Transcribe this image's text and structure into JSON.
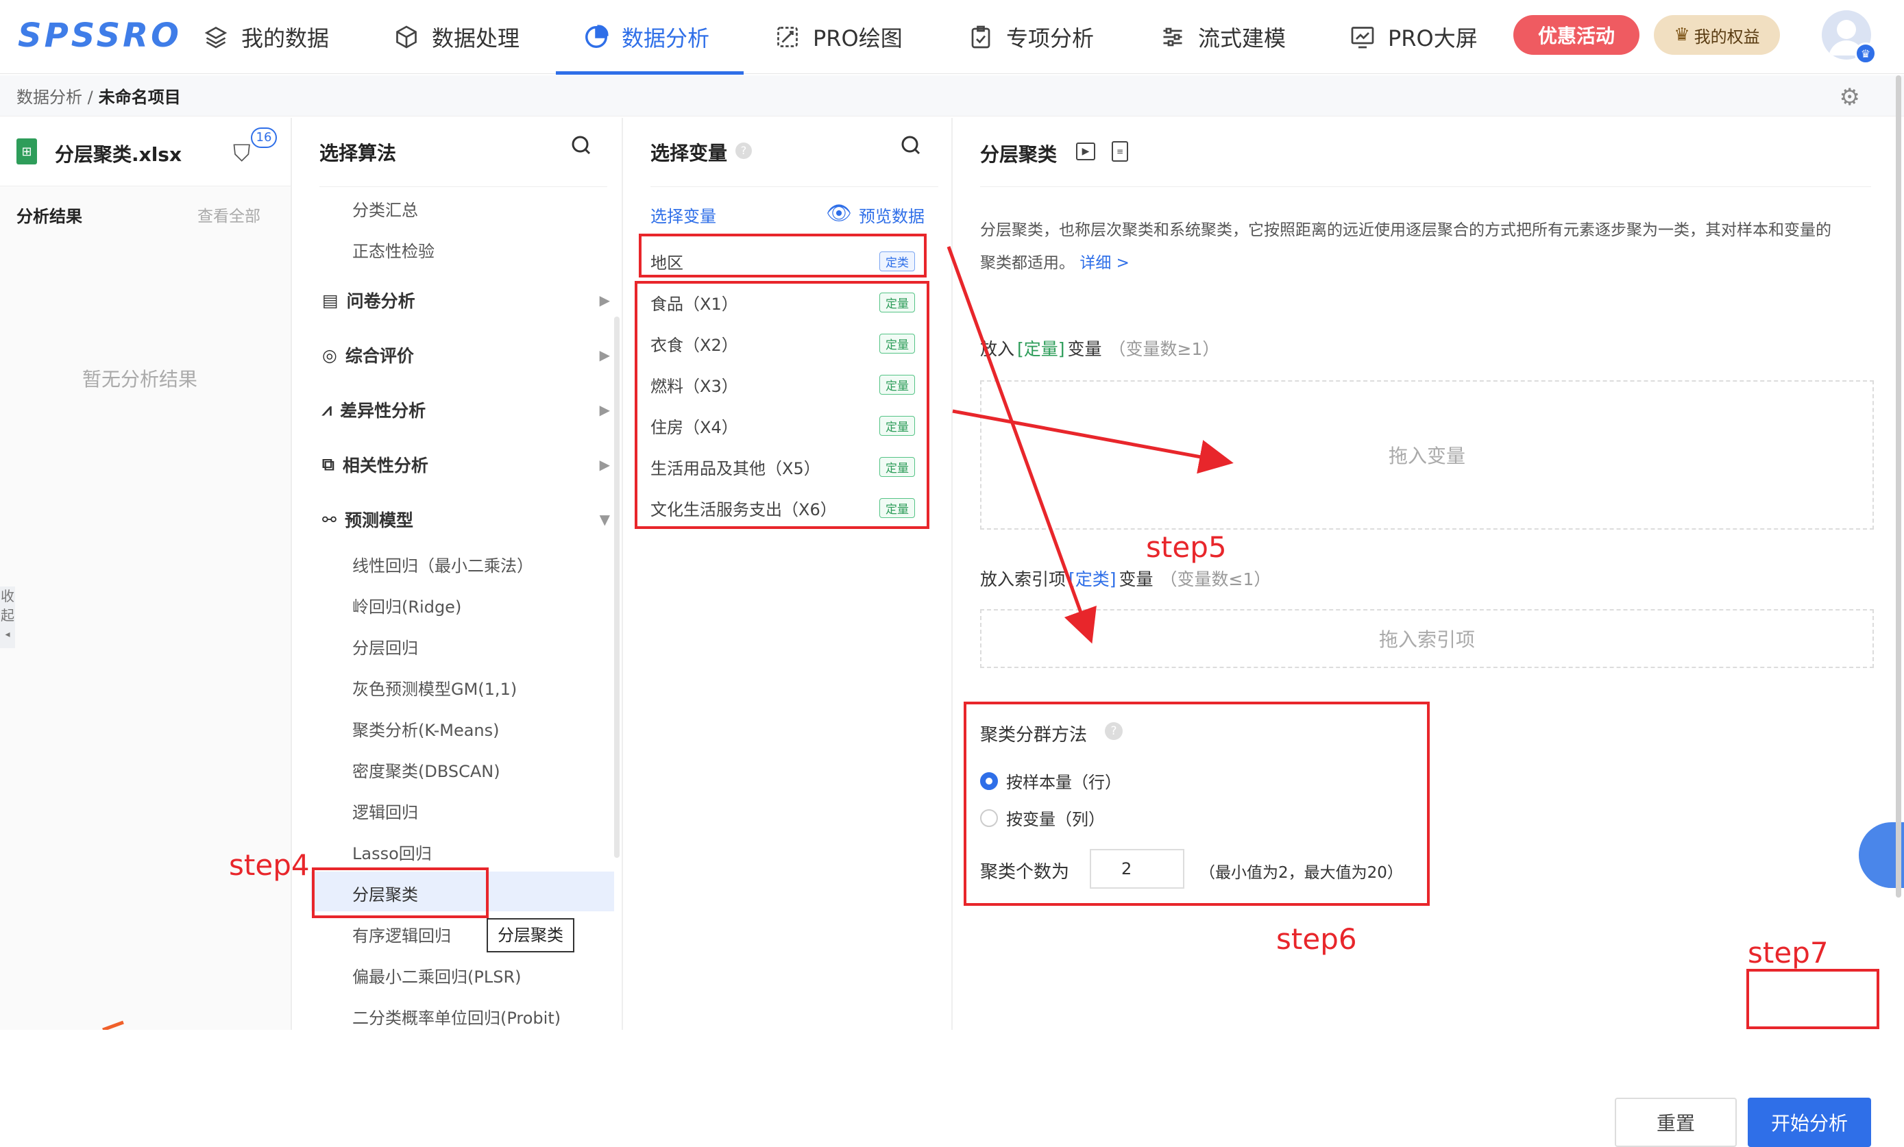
{
  "app": {
    "logo": "SPSSRO"
  },
  "nav": [
    {
      "label": "我的数据",
      "icon": "layers-icon"
    },
    {
      "label": "数据处理",
      "icon": "cube-icon"
    },
    {
      "label": "数据分析",
      "icon": "pie-icon",
      "active": true
    },
    {
      "label": "PRO绘图",
      "icon": "brush-icon"
    },
    {
      "label": "专项分析",
      "icon": "clipboard-icon"
    },
    {
      "label": "流式建模",
      "icon": "sliders-icon"
    },
    {
      "label": "PRO大屏",
      "icon": "monitor-chart-icon"
    }
  ],
  "promo_label": "优惠活动",
  "rights_label": "我的权益",
  "breadcrumb": {
    "parent": "数据分析 /",
    "current": "未命名项目"
  },
  "file": {
    "name": "分层聚类.xlsx",
    "filter_count": "16"
  },
  "results": {
    "title": "分析结果",
    "view_all": "查看全部",
    "empty": "暂无分析结果"
  },
  "collapse_label": [
    "收",
    "起"
  ],
  "algo": {
    "title": "选择算法",
    "top_items": [
      "分类汇总",
      "正态性检验"
    ],
    "groups": [
      "问卷分析",
      "综合评价",
      "差异性分析",
      "相关性分析",
      "预测模型"
    ],
    "model_items": [
      "线性回归（最小二乘法）",
      "岭回归(Ridge)",
      "分层回归",
      "灰色预测模型GM(1,1)",
      "聚类分析(K-Means)",
      "密度聚类(DBSCAN)",
      "逻辑回归",
      "Lasso回归",
      "分层聚类",
      "有序逻辑回归",
      "偏最小二乘回归(PLSR)",
      "二分类概率单位回归(Probit)"
    ],
    "tooltip": "分层聚类"
  },
  "vars": {
    "title": "选择变量",
    "sub": "选择变量",
    "preview": "预览数据",
    "items": [
      {
        "name": "地区",
        "tag": "定类",
        "kind": "blue"
      },
      {
        "name": "食品（X1）",
        "tag": "定量",
        "kind": "green"
      },
      {
        "name": "衣食（X2）",
        "tag": "定量",
        "kind": "green"
      },
      {
        "name": "燃料（X3）",
        "tag": "定量",
        "kind": "green"
      },
      {
        "name": "住房（X4）",
        "tag": "定量",
        "kind": "green"
      },
      {
        "name": "生活用品及其他（X5）",
        "tag": "定量",
        "kind": "green"
      },
      {
        "name": "文化生活服务支出（X6）",
        "tag": "定量",
        "kind": "green"
      }
    ]
  },
  "panel": {
    "title": "分层聚类",
    "desc1": "分层聚类，也称层次聚类和系统聚类，它按照距离的远近使用逐层聚合的方式把所有元素逐步聚为一类，其对样本和变量的",
    "desc2": "聚类都适用。",
    "detail_link": "详细 >",
    "zone1_label_pre": "放入",
    "zone1_tag": "[定量]",
    "zone1_label_post": "变量",
    "zone1_limit": "（变量数≥1）",
    "zone1_placeholder": "拖入变量",
    "zone2_label_pre": "放入索引项",
    "zone2_tag": "[定类]",
    "zone2_label_post": "变量",
    "zone2_limit": "（变量数≤1）",
    "zone2_placeholder": "拖入索引项",
    "method_title": "聚类分群方法",
    "option_rows": "按样本量（行）",
    "option_cols": "按变量（列）",
    "cluster_label": "聚类个数为",
    "cluster_value": "2",
    "cluster_hint": "（最小值为2，最大值为20）",
    "reset": "重置",
    "start": "开始分析"
  },
  "annotations": {
    "step4": "step4",
    "step5": "step5",
    "step6": "step6",
    "step7": "step7"
  },
  "colors": {
    "accent": "#2f6fe8",
    "annotation": "#e8262b",
    "promo": "#ef5b61",
    "green_tag": "#2e9d5a"
  }
}
